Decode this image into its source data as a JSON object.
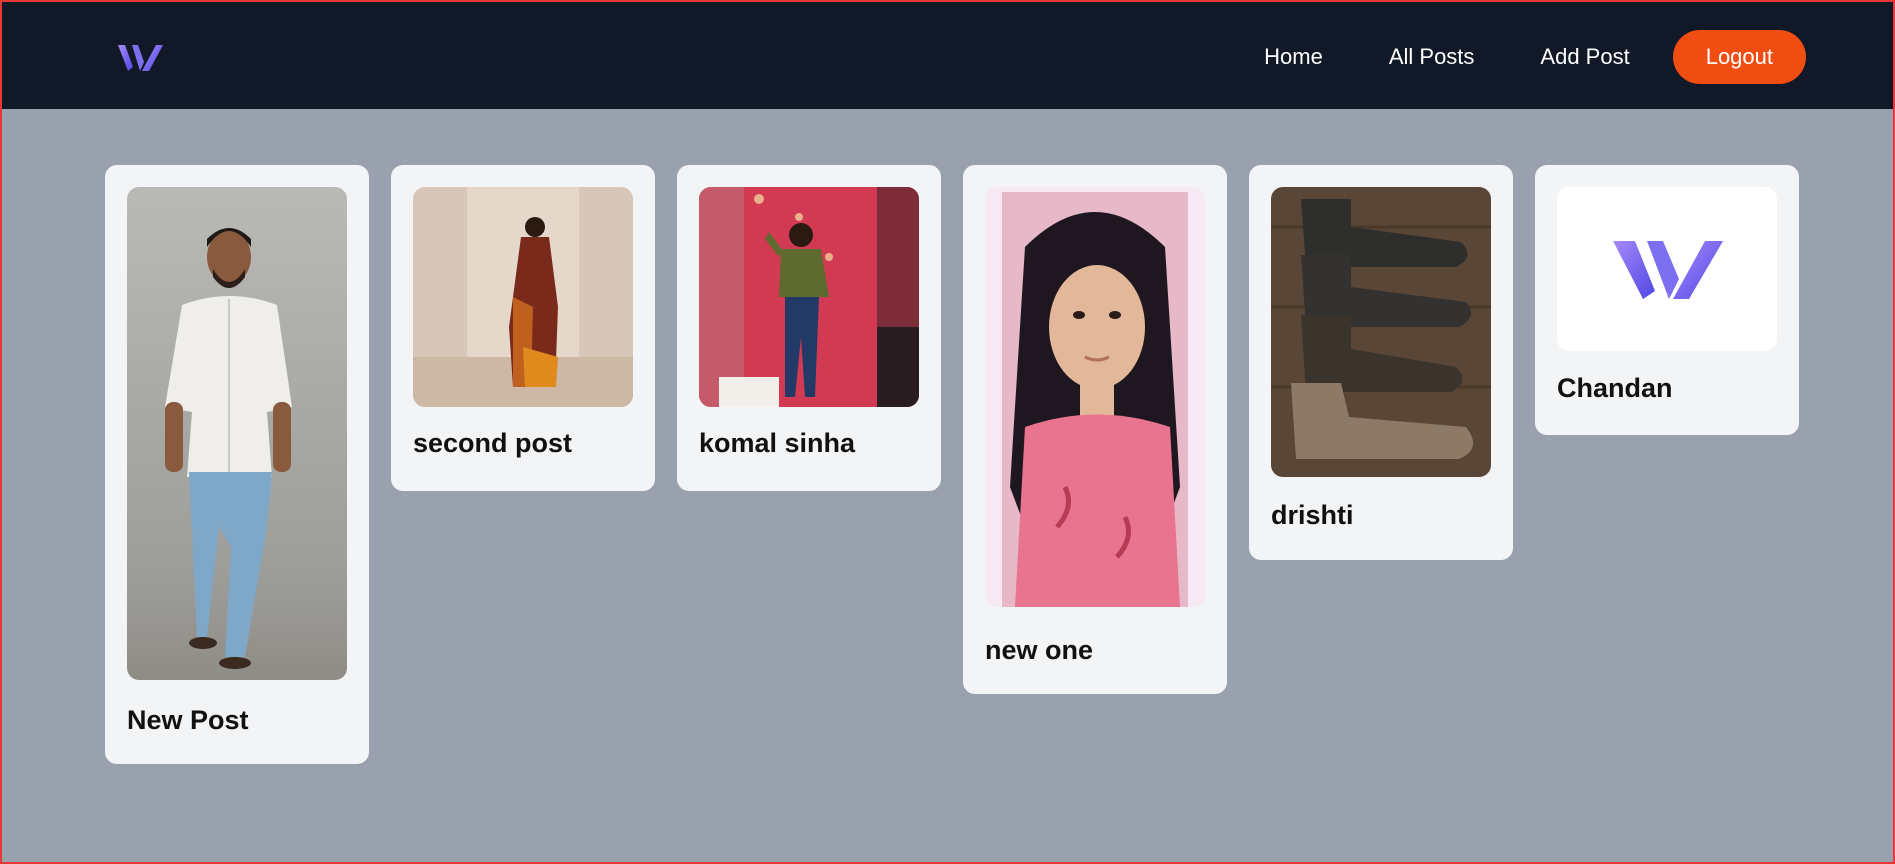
{
  "navbar": {
    "logo_name": "logo-icon",
    "links": [
      "Home",
      "All Posts",
      "Add Post"
    ],
    "logout_label": "Logout",
    "accent_color": "#f04d12",
    "background_color": "#111827"
  },
  "posts": [
    {
      "title": "New Post",
      "image": "person-standing-photo"
    },
    {
      "title": "second post",
      "image": "woman-in-saree-photo"
    },
    {
      "title": "komal sinha",
      "image": "woman-red-wall-photo"
    },
    {
      "title": "new one",
      "image": "selfie-photo"
    },
    {
      "title": "drishti",
      "image": "boots-photo"
    },
    {
      "title": "Chandan",
      "image": "logo-image"
    }
  ]
}
